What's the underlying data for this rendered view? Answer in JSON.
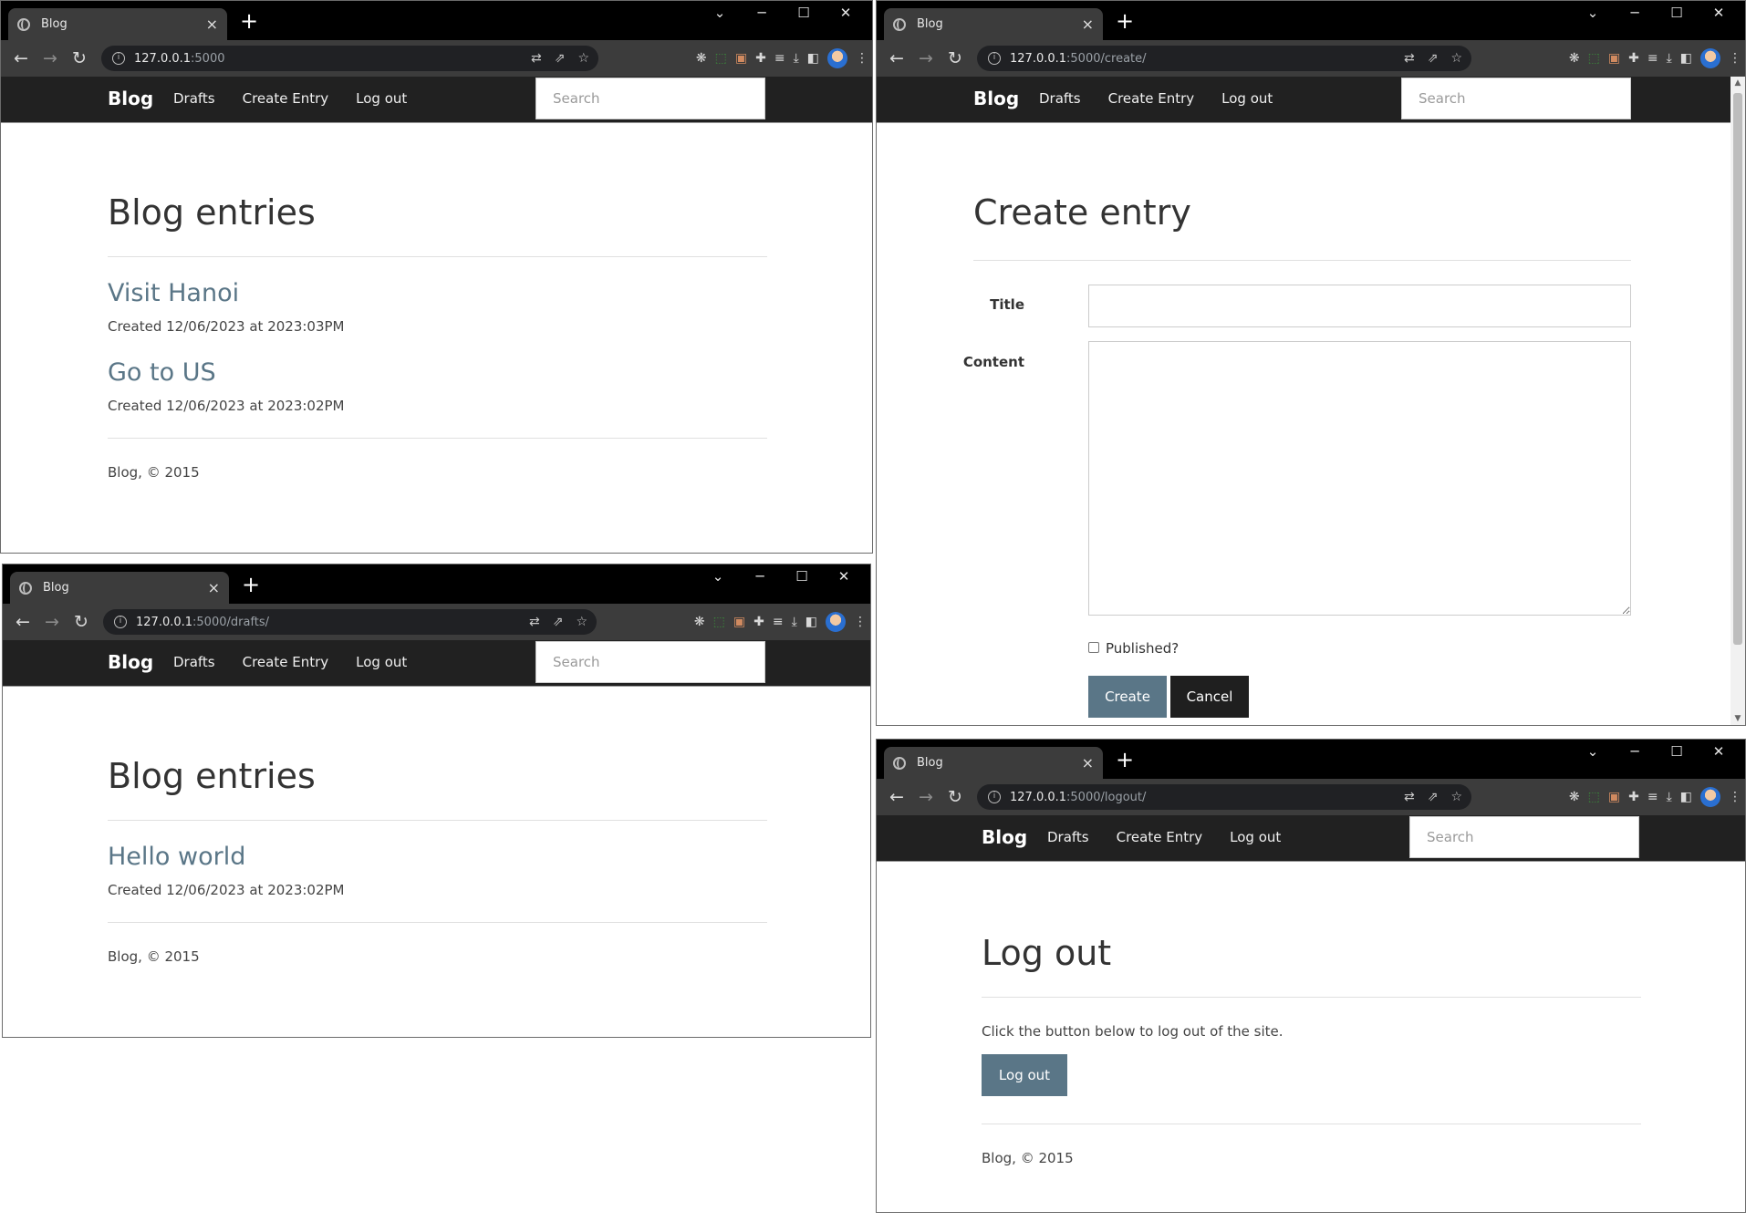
{
  "chrome": {
    "tab_title": "Blog",
    "tab_close": "×",
    "new_tab": "+",
    "window_controls": [
      "⌄",
      "─",
      "☐",
      "✕"
    ],
    "back": "←",
    "forward": "→",
    "reload": "↻",
    "info": "i"
  },
  "app": {
    "brand": "Blog",
    "nav": [
      "Drafts",
      "Create Entry",
      "Log out"
    ],
    "search_placeholder": "Search",
    "footer": "Blog, © 2015"
  },
  "windows": {
    "home": {
      "url_host": "127.0.0.1",
      "url_path": ":5000",
      "heading": "Blog entries",
      "entries": [
        {
          "title": "Visit Hanoi",
          "meta": "Created 12/06/2023 at 2023:03PM"
        },
        {
          "title": "Go to US",
          "meta": "Created 12/06/2023 at 2023:02PM"
        }
      ]
    },
    "create": {
      "url_host": "127.0.0.1",
      "url_path": ":5000/create/",
      "heading": "Create entry",
      "title_label": "Title",
      "content_label": "Content",
      "published_label": "Published?",
      "create_button": "Create",
      "cancel_button": "Cancel"
    },
    "drafts": {
      "url_host": "127.0.0.1",
      "url_path": ":5000/drafts/",
      "heading": "Blog entries",
      "entries": [
        {
          "title": "Hello world",
          "meta": "Created 12/06/2023 at 2023:02PM"
        }
      ]
    },
    "logout": {
      "url_host": "127.0.0.1",
      "url_path": ":5000/logout/",
      "heading": "Log out",
      "message": "Click the button below to log out of the site.",
      "logout_button": "Log out"
    }
  },
  "colors": {
    "accent": "#5a7687",
    "navbar": "#212121",
    "chrome_dark": "#3c3c3c"
  }
}
